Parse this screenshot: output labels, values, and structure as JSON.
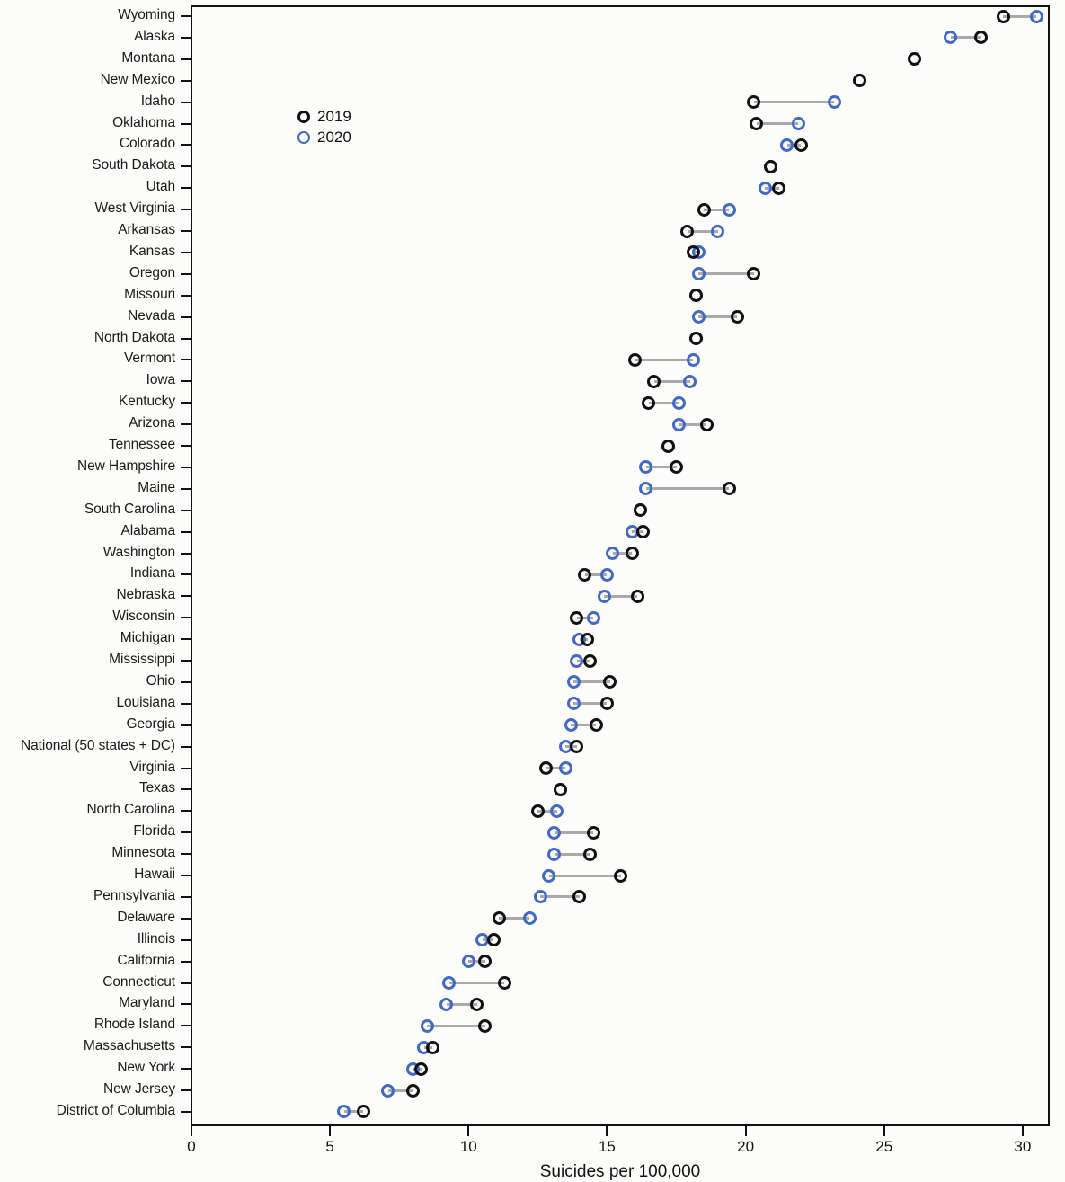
{
  "chart_data": {
    "type": "scatter",
    "subtype": "dumbbell",
    "title": "",
    "xlabel": "Suicides per 100,000",
    "ylabel": "",
    "xlim": [
      0,
      31.5
    ],
    "xticks": [
      0,
      5,
      10,
      15,
      20,
      25,
      30
    ],
    "xticklabels": [
      "0",
      "5",
      "10",
      "15",
      "20",
      "25",
      "30"
    ],
    "grid": false,
    "legend_position": "upper-left-inside",
    "series": [
      {
        "name": "2019",
        "color": "#111111",
        "marker": "open-circle"
      },
      {
        "name": "2020",
        "color": "#4169c9",
        "marker": "open-circle"
      }
    ],
    "categories": [
      "Wyoming",
      "Alaska",
      "Montana",
      "New Mexico",
      "Idaho",
      "Oklahoma",
      "Colorado",
      "South Dakota",
      "Utah",
      "West Virginia",
      "Arkansas",
      "Kansas",
      "Oregon",
      "Missouri",
      "Nevada",
      "North Dakota",
      "Vermont",
      "Iowa",
      "Kentucky",
      "Arizona",
      "Tennessee",
      "New Hampshire",
      "Maine",
      "South Carolina",
      "Alabama",
      "Washington",
      "Indiana",
      "Nebraska",
      "Wisconsin",
      "Michigan",
      "Mississippi",
      "Ohio",
      "Louisiana",
      "Georgia",
      "National (50 states + DC)",
      "Virginia",
      "Texas",
      "North Carolina",
      "Florida",
      "Minnesota",
      "Hawaii",
      "Pennsylvania",
      "Delaware",
      "Illinois",
      "California",
      "Connecticut",
      "Maryland",
      "Rhode Island",
      "Massachusetts",
      "New York",
      "New Jersey",
      "District of Columbia"
    ],
    "values_2019": [
      29.3,
      28.5,
      26.1,
      24.1,
      20.3,
      20.4,
      22.0,
      20.9,
      21.2,
      18.5,
      17.9,
      18.1,
      20.3,
      18.2,
      19.7,
      18.2,
      16.0,
      16.7,
      16.5,
      18.6,
      17.2,
      17.5,
      19.4,
      16.2,
      16.3,
      15.9,
      14.2,
      16.1,
      13.9,
      14.3,
      14.4,
      15.1,
      15.0,
      14.6,
      13.9,
      12.8,
      13.3,
      12.5,
      14.5,
      14.4,
      15.5,
      14.0,
      11.1,
      10.9,
      10.6,
      11.3,
      10.3,
      10.6,
      8.7,
      8.3,
      8.0,
      6.2
    ],
    "values_2020": [
      30.5,
      27.4,
      26.1,
      24.1,
      23.2,
      21.9,
      21.5,
      20.9,
      20.7,
      19.4,
      19.0,
      18.3,
      18.3,
      18.2,
      18.3,
      18.2,
      18.1,
      18.0,
      17.6,
      17.6,
      17.2,
      16.4,
      16.4,
      16.2,
      15.9,
      15.2,
      15.0,
      14.9,
      14.5,
      14.0,
      13.9,
      13.8,
      13.8,
      13.7,
      13.5,
      13.5,
      13.3,
      13.2,
      13.1,
      13.1,
      12.9,
      12.6,
      12.2,
      10.5,
      10.0,
      9.3,
      9.2,
      8.5,
      8.4,
      8.0,
      7.1,
      5.5
    ]
  },
  "legend": {
    "entries": [
      {
        "label": "2019"
      },
      {
        "label": "2020"
      }
    ]
  },
  "axis": {
    "x_title": "Suicides per 100,000"
  }
}
